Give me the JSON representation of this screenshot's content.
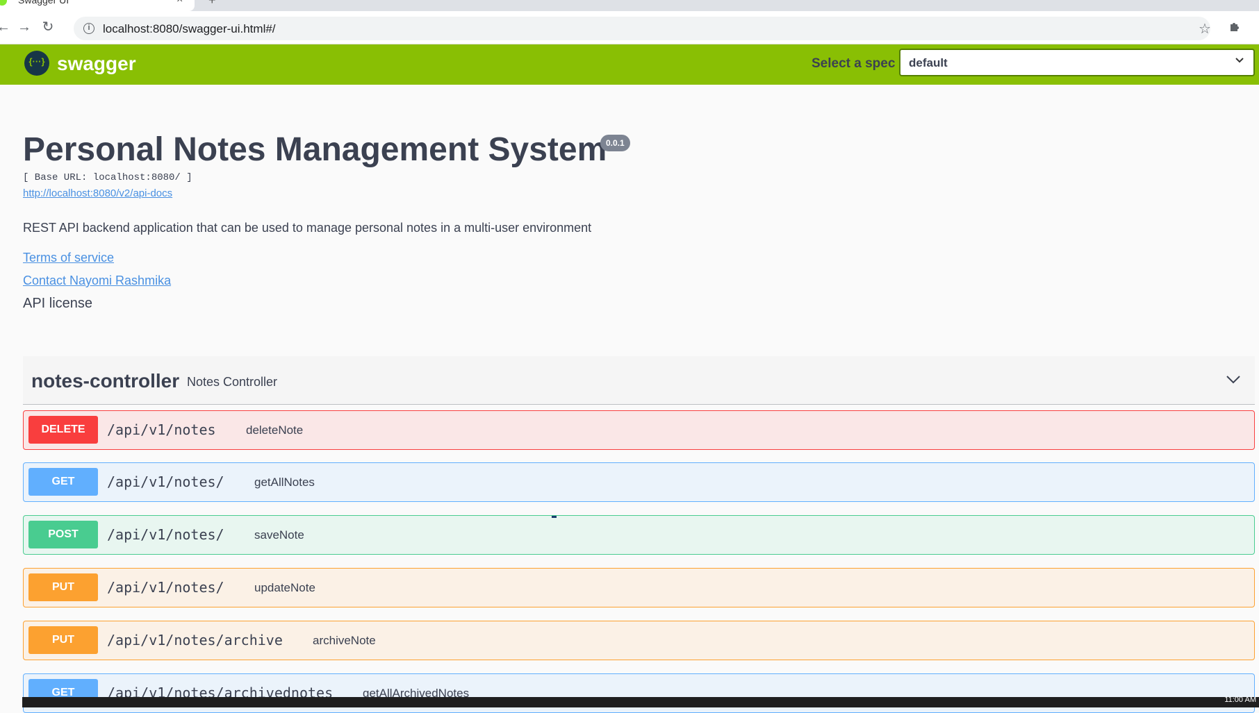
{
  "browser": {
    "tab_title": "Swagger UI",
    "url": "localhost:8080/swagger-ui.html#/"
  },
  "topbar": {
    "logo_text": "swagger",
    "spec_label": "Select a spec",
    "spec_value": "default"
  },
  "info": {
    "title": "Personal Notes Management System",
    "version": "0.0.1",
    "base_url": "[ Base URL: localhost:8080/ ]",
    "api_docs_link": "http://localhost:8080/v2/api-docs",
    "description": "REST API backend application that can be used to manage personal notes in a multi-user environment",
    "terms_link": "Terms of service",
    "contact_link": "Contact Nayomi Rashmika",
    "license_text": "API license"
  },
  "controller": {
    "name": "notes-controller",
    "description": "Notes Controller",
    "operations": [
      {
        "method": "DELETE",
        "path": "/api/v1/notes",
        "summary": "deleteNote"
      },
      {
        "method": "GET",
        "path": "/api/v1/notes/",
        "summary": "getAllNotes"
      },
      {
        "method": "POST",
        "path": "/api/v1/notes/",
        "summary": "saveNote"
      },
      {
        "method": "PUT",
        "path": "/api/v1/notes/",
        "summary": "updateNote"
      },
      {
        "method": "PUT",
        "path": "/api/v1/notes/archive",
        "summary": "archiveNote"
      },
      {
        "method": "GET",
        "path": "/api/v1/notes/archivednotes",
        "summary": "getAllArchivedNotes"
      }
    ]
  },
  "taskbar": {
    "time": "11:00 AM"
  },
  "colors": {
    "topbar": "#89bf04",
    "delete": "#f93e3e",
    "get": "#61affe",
    "post": "#49cc90",
    "put": "#fca130",
    "link": "#4990e2"
  },
  "icons": [
    "info-icon",
    "star-icon",
    "extensions-icon",
    "back-icon",
    "forward-icon",
    "reload-icon",
    "chevron-down-icon",
    "swagger-logo-icon"
  ]
}
